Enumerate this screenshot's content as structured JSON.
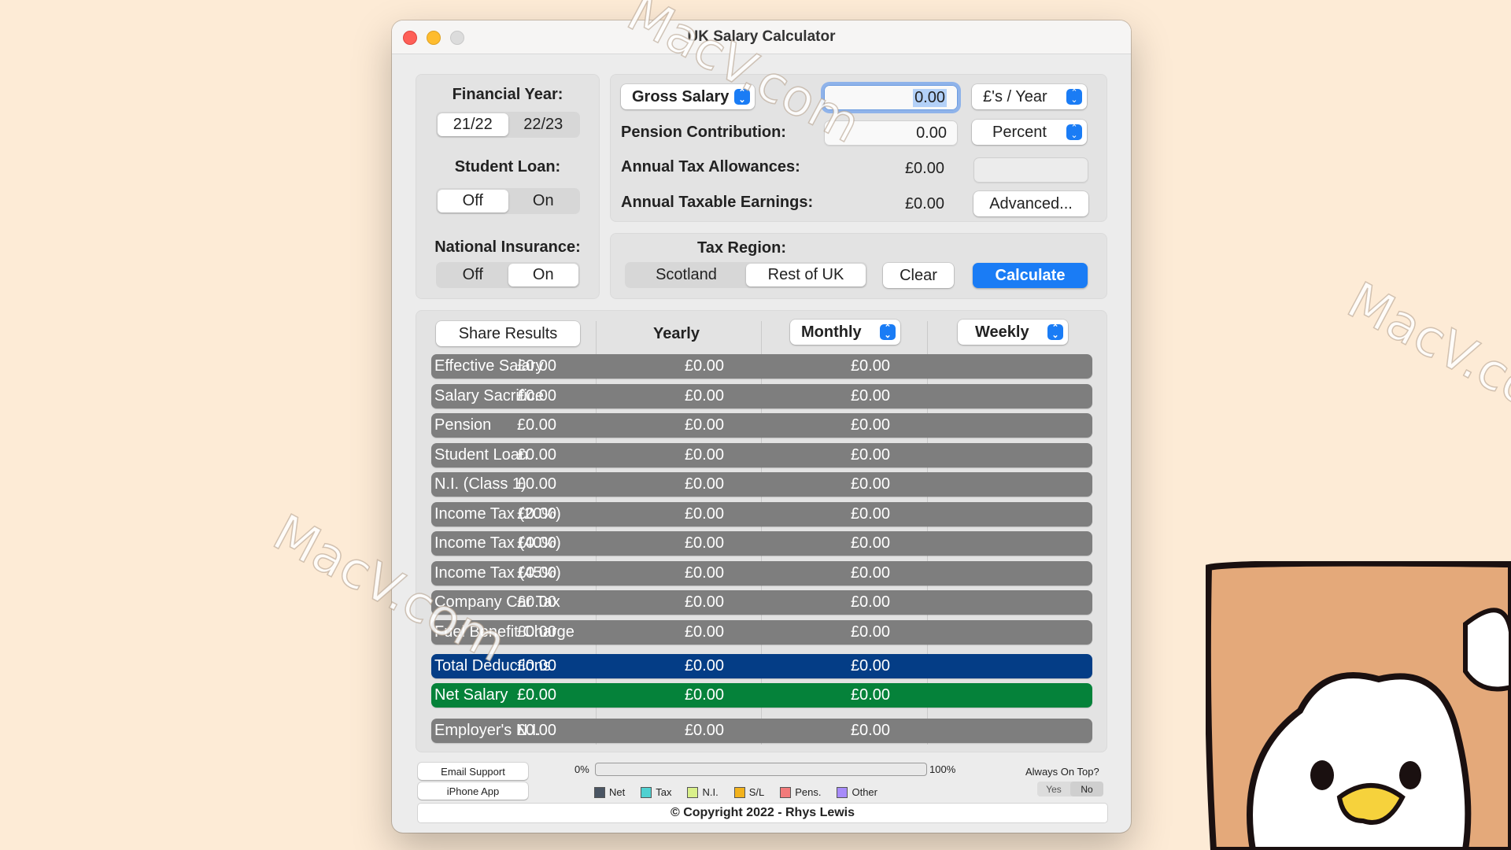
{
  "window": {
    "title": "UK Salary Calculator"
  },
  "settings": {
    "financial_year": {
      "label": "Financial Year:",
      "options": [
        "21/22",
        "22/23"
      ],
      "selected": "21/22"
    },
    "student_loan": {
      "label": "Student Loan:",
      "options": [
        "Off",
        "On"
      ],
      "selected": "Off"
    },
    "national_insurance": {
      "label": "National Insurance:",
      "options": [
        "Off",
        "On"
      ],
      "selected": "On"
    }
  },
  "inputs": {
    "salary_type": "Gross Salary",
    "salary_value": "0.00",
    "salary_period": "£'s / Year",
    "pension_label": "Pension Contribution:",
    "pension_value": "0.00",
    "pension_unit": "Percent",
    "allowances_label": "Annual Tax Allowances:",
    "allowances_value": "£0.00",
    "taxable_label": "Annual Taxable Earnings:",
    "taxable_value": "£0.00",
    "advanced_label": "Advanced..."
  },
  "tax_region": {
    "label": "Tax Region:",
    "options": [
      "Scotland",
      "Rest of UK"
    ],
    "selected": "Rest of UK",
    "clear_label": "Clear",
    "calculate_label": "Calculate"
  },
  "results": {
    "share_label": "Share Results",
    "columns": [
      "Yearly",
      "Monthly",
      "Weekly"
    ],
    "rows": [
      {
        "name": "Effective Salary",
        "yearly": "£0.00",
        "monthly": "£0.00",
        "weekly": "£0.00"
      },
      {
        "name": "Salary Sacrifice",
        "yearly": "£0.00",
        "monthly": "£0.00",
        "weekly": "£0.00"
      },
      {
        "name": "Pension",
        "yearly": "£0.00",
        "monthly": "£0.00",
        "weekly": "£0.00"
      },
      {
        "name": "Student Loan",
        "yearly": "£0.00",
        "monthly": "£0.00",
        "weekly": "£0.00"
      },
      {
        "name": "N.I. (Class 1)",
        "yearly": "£0.00",
        "monthly": "£0.00",
        "weekly": "£0.00"
      },
      {
        "name": "Income Tax (20%)",
        "yearly": "£0.00",
        "monthly": "£0.00",
        "weekly": "£0.00"
      },
      {
        "name": "Income Tax (40%)",
        "yearly": "£0.00",
        "monthly": "£0.00",
        "weekly": "£0.00"
      },
      {
        "name": "Income Tax (45%)",
        "yearly": "£0.00",
        "monthly": "£0.00",
        "weekly": "£0.00"
      },
      {
        "name": "Company Car Tax",
        "yearly": "£0.00",
        "monthly": "£0.00",
        "weekly": "£0.00"
      },
      {
        "name": "Fuel Benefit Charge",
        "yearly": "£0.00",
        "monthly": "£0.00",
        "weekly": "£0.00"
      }
    ],
    "total": {
      "name": "Total Deductions",
      "yearly": "£0.00",
      "monthly": "£0.00",
      "weekly": "£0.00"
    },
    "net": {
      "name": "Net Salary",
      "yearly": "£0.00",
      "monthly": "£0.00",
      "weekly": "£0.00"
    },
    "employer": {
      "name": "Employer's N.I.",
      "yearly": "£0.00",
      "monthly": "£0.00",
      "weekly": "£0.00"
    }
  },
  "footer": {
    "email_support": "Email Support",
    "iphone_app": "iPhone App",
    "progress_min": "0%",
    "progress_max": "100%",
    "progress_value": 0,
    "legend": [
      {
        "label": "Net",
        "color": "#4a5563"
      },
      {
        "label": "Tax",
        "color": "#4fd1d1"
      },
      {
        "label": "N.I.",
        "color": "#d9f08a"
      },
      {
        "label": "S/L",
        "color": "#f2b21c"
      },
      {
        "label": "Pens.",
        "color": "#f27a7a"
      },
      {
        "label": "Other",
        "color": "#a78bfa"
      }
    ],
    "always_on_top_label": "Always On Top?",
    "always_on_top_options": [
      "Yes",
      "No"
    ],
    "always_on_top_selected": "No",
    "copyright": "© Copyright 2022 - Rhys Lewis"
  },
  "watermark": "MacV.com"
}
